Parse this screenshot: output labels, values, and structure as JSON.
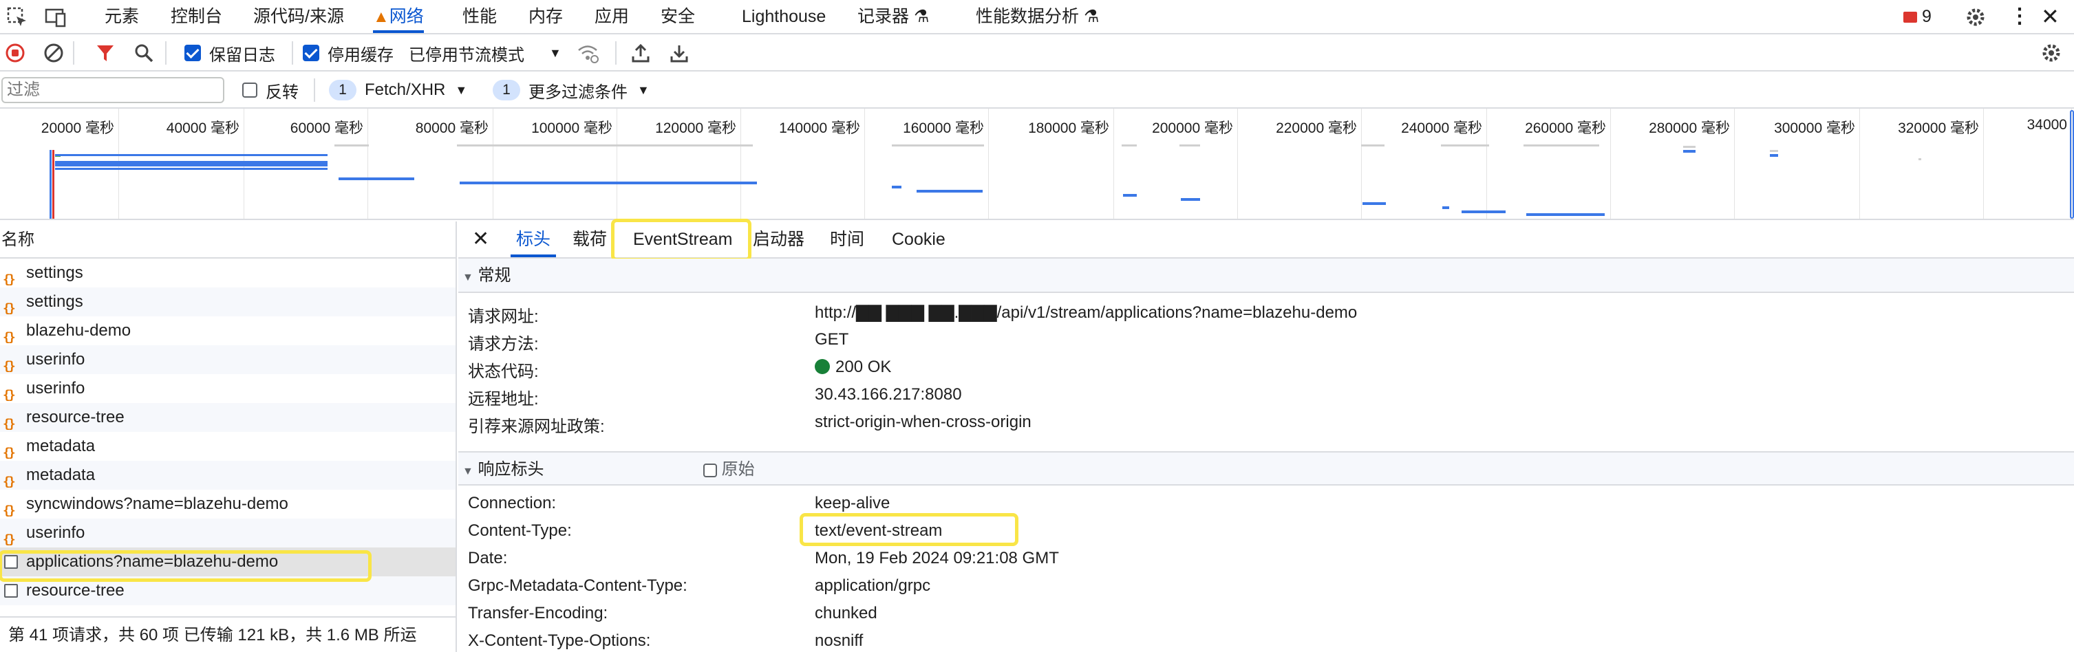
{
  "top_tabs": [
    {
      "label": "元素"
    },
    {
      "label": "控制台"
    },
    {
      "label": "源代码/来源"
    },
    {
      "label": "网络",
      "active": true
    },
    {
      "label": "性能"
    },
    {
      "label": "内存"
    },
    {
      "label": "应用"
    },
    {
      "label": "安全"
    },
    {
      "label": "Lighthouse"
    },
    {
      "label": "记录器"
    },
    {
      "label": "性能数据分析"
    }
  ],
  "issues_count": "9",
  "toolbar": {
    "preserve_log": "保留日志",
    "disable_cache": "停用缓存",
    "throttle": "已停用节流模式"
  },
  "filter": {
    "placeholder": "过滤",
    "invert": "反转",
    "type_count": "1",
    "type_label": "Fetch/XHR",
    "more_count": "1",
    "more_label": "更多过滤条件"
  },
  "overview_ticks": [
    "20000 毫秒",
    "40000 毫秒",
    "60000 毫秒",
    "80000 毫秒",
    "100000 毫秒",
    "120000 毫秒",
    "140000 毫秒",
    "160000 毫秒",
    "180000 毫秒",
    "200000 毫秒",
    "220000 毫秒",
    "240000 毫秒",
    "260000 毫秒",
    "280000 毫秒",
    "300000 毫秒",
    "320000 毫秒",
    "34000"
  ],
  "list": {
    "header": "名称",
    "rows": [
      {
        "name": "settings",
        "icon": "json-icon"
      },
      {
        "name": "settings",
        "icon": "json-icon"
      },
      {
        "name": "blazehu-demo",
        "icon": "json-icon"
      },
      {
        "name": "userinfo",
        "icon": "json-icon"
      },
      {
        "name": "userinfo",
        "icon": "json-icon"
      },
      {
        "name": "resource-tree",
        "icon": "json-icon"
      },
      {
        "name": "metadata",
        "icon": "json-icon"
      },
      {
        "name": "metadata",
        "icon": "json-icon"
      },
      {
        "name": "syncwindows?name=blazehu-demo",
        "icon": "json-icon"
      },
      {
        "name": "userinfo",
        "icon": "json-icon"
      },
      {
        "name": "applications?name=blazehu-demo",
        "icon": "document-icon",
        "selected": true
      },
      {
        "name": "resource-tree",
        "icon": "document-icon"
      }
    ],
    "status": "第 41 项请求，共 60 项   已传输 121 kB，共 1.6 MB   所运"
  },
  "detail": {
    "tabs": [
      "标头",
      "载荷",
      "EventStream",
      "启动器",
      "时间",
      "Cookie"
    ],
    "general": {
      "title": "常规",
      "rows": [
        {
          "k": "请求网址:",
          "v": "http://▇▇    ▇▇▇    ▇▇.▇▇▇/api/v1/stream/applications?name=blazehu-demo"
        },
        {
          "k": "请求方法:",
          "v": "GET"
        },
        {
          "k": "状态代码:",
          "v": "200 OK"
        },
        {
          "k": "远程地址:",
          "v": "30.43.166.217:8080"
        },
        {
          "k": "引荐来源网址政策:",
          "v": "strict-origin-when-cross-origin"
        }
      ]
    },
    "response": {
      "title": "响应标头",
      "raw": "原始",
      "rows": [
        {
          "k": "Connection:",
          "v": "keep-alive"
        },
        {
          "k": "Content-Type:",
          "v": "text/event-stream"
        },
        {
          "k": "Date:",
          "v": "Mon, 19 Feb 2024 09:21:08 GMT"
        },
        {
          "k": "Grpc-Metadata-Content-Type:",
          "v": "application/grpc"
        },
        {
          "k": "Transfer-Encoding:",
          "v": "chunked"
        },
        {
          "k": "X-Content-Type-Options:",
          "v": "nosniff"
        }
      ]
    }
  }
}
